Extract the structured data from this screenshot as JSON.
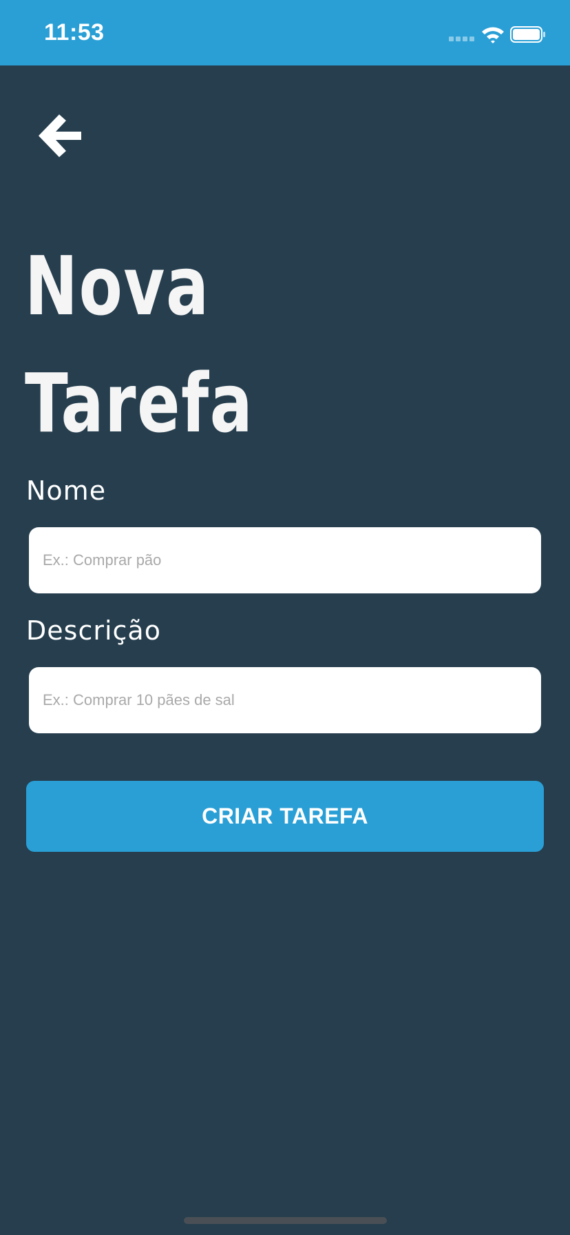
{
  "status_bar": {
    "time": "11:53",
    "background": "#299fd6",
    "icons": [
      "signal-icon",
      "wifi-icon",
      "battery-icon"
    ]
  },
  "header": {
    "back_icon": "arrow-left-icon"
  },
  "page": {
    "title_line1": "Nova",
    "title_line2": "Tarefa",
    "background": "#263e4e"
  },
  "form": {
    "name_label": "Nome",
    "name_placeholder": "Ex.: Comprar pão",
    "name_value": "",
    "description_label": "Descrição",
    "description_placeholder": "Ex.: Comprar 10 pães de sal",
    "description_value": "",
    "submit_label": "CRIAR TAREFA",
    "accent": "#299fd6"
  }
}
